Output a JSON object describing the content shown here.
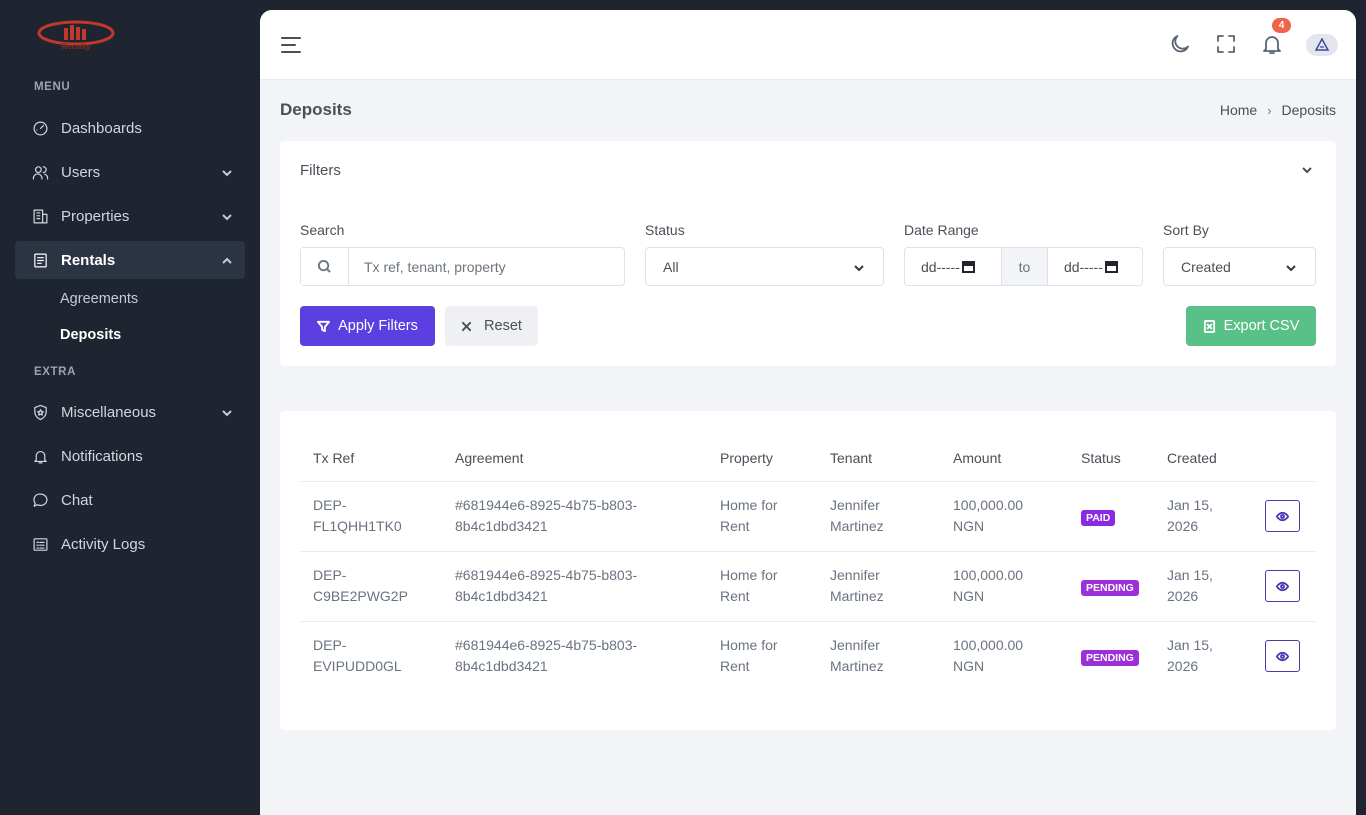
{
  "sidebar": {
    "logo_text": "Reculty",
    "menu_title": "MENU",
    "extra_title": "EXTRA",
    "items": [
      {
        "label": "Dashboards",
        "icon": "dashboard-icon"
      },
      {
        "label": "Users",
        "icon": "users-icon"
      },
      {
        "label": "Properties",
        "icon": "building-icon"
      },
      {
        "label": "Rentals",
        "icon": "document-icon"
      },
      {
        "label": "Miscellaneous",
        "icon": "shield-star-icon"
      },
      {
        "label": "Notifications",
        "icon": "bell-icon"
      },
      {
        "label": "Chat",
        "icon": "chat-icon"
      },
      {
        "label": "Activity Logs",
        "icon": "activity-log-icon"
      }
    ],
    "rentals_sub": [
      {
        "label": "Agreements"
      },
      {
        "label": "Deposits"
      }
    ]
  },
  "topbar": {
    "notification_count": "4"
  },
  "page": {
    "title": "Deposits",
    "breadcrumb": [
      "Home",
      "Deposits"
    ]
  },
  "filters": {
    "title": "Filters",
    "search_label": "Search",
    "search_placeholder": "Tx ref, tenant, property",
    "status_label": "Status",
    "status_value": "All",
    "date_label": "Date Range",
    "date_from": "dd-----",
    "date_to_sep": "to",
    "date_to": "dd-----",
    "sort_label": "Sort By",
    "sort_value": "Created",
    "apply_label": "Apply Filters",
    "reset_label": "Reset",
    "export_label": "Export CSV"
  },
  "table": {
    "columns": [
      "Tx Ref",
      "Agreement",
      "Property",
      "Tenant",
      "Amount",
      "Status",
      "Created"
    ],
    "rows": [
      {
        "tx_ref_1": "DEP-",
        "tx_ref_2": "FL1QHH1TK0",
        "agreement_1": "#681944e6-8925-4b75-b803-",
        "agreement_2": "8b4c1dbd3421",
        "property_1": "Home for",
        "property_2": "Rent",
        "tenant_1": "Jennifer",
        "tenant_2": "Martinez",
        "amount_1": "100,000.00",
        "amount_2": "NGN",
        "status": "PAID",
        "created_1": "Jan 15,",
        "created_2": "2026"
      },
      {
        "tx_ref_1": "DEP-",
        "tx_ref_2": "C9BE2PWG2P",
        "agreement_1": "#681944e6-8925-4b75-b803-",
        "agreement_2": "8b4c1dbd3421",
        "property_1": "Home for",
        "property_2": "Rent",
        "tenant_1": "Jennifer",
        "tenant_2": "Martinez",
        "amount_1": "100,000.00",
        "amount_2": "NGN",
        "status": "PENDING",
        "created_1": "Jan 15,",
        "created_2": "2026"
      },
      {
        "tx_ref_1": "DEP-",
        "tx_ref_2": "EVIPUDD0GL",
        "agreement_1": "#681944e6-8925-4b75-b803-",
        "agreement_2": "8b4c1dbd3421",
        "property_1": "Home for",
        "property_2": "Rent",
        "tenant_1": "Jennifer",
        "tenant_2": "Martinez",
        "amount_1": "100,000.00",
        "amount_2": "NGN",
        "status": "PENDING",
        "created_1": "Jan 15,",
        "created_2": "2026"
      }
    ]
  },
  "colors": {
    "sidebar_bg": "#1e2530",
    "primary": "#5b3fe0",
    "success": "#59c187",
    "badge": "#8a2be2",
    "notification": "#f06548"
  }
}
